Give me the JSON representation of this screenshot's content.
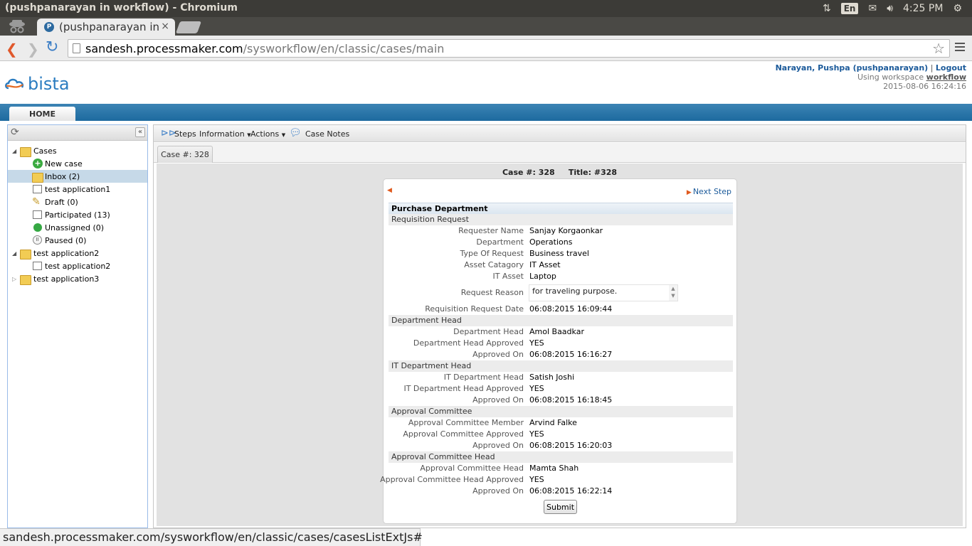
{
  "os": {
    "window_title": "(pushpanarayan in workflow) - Chromium",
    "lang": "En",
    "time": "4:25 PM"
  },
  "browser": {
    "tab_title": "(pushpanarayan in",
    "tab_favicon_letter": "P",
    "url_host": "sandesh.processmaker.com",
    "url_path": "/sysworkflow/en/classic/cases/main",
    "status_url": "sandesh.processmaker.com/sysworkflow/en/classic/cases/casesListExtJs#"
  },
  "header": {
    "logo_text": "bista",
    "user_name": "Narayan, Pushpa (pushpanarayan)",
    "separator": "|",
    "logout": "Logout",
    "workspace_prefix": "Using workspace",
    "workspace": "workflow",
    "datetime": "2015-08-06 16:24:16"
  },
  "menu": {
    "home": "HOME"
  },
  "tree": {
    "root": "Cases",
    "items": [
      {
        "label": "New case"
      },
      {
        "label": "Inbox (2)"
      },
      {
        "label": "test application1"
      },
      {
        "label": "Draft (0)"
      },
      {
        "label": "Participated (13)"
      },
      {
        "label": "Unassigned (0)"
      },
      {
        "label": "Paused (0)"
      }
    ],
    "group2": "test application2",
    "group2_child": "test application2",
    "group3": "test application3"
  },
  "toolbar": {
    "steps": "Steps",
    "information": "Information",
    "actions": "Actions",
    "case_notes": "Case Notes"
  },
  "case_tab": "Case #: 328",
  "case_header": {
    "case_label": "Case #: 328",
    "title_label": "Title: #328"
  },
  "form": {
    "next_step": "Next Step",
    "title": "Purchase Department",
    "sections": [
      "Requisition Request",
      "Department Head",
      "IT Department Head",
      "Approval Committee",
      "Approval Committee Head"
    ],
    "requisition": [
      {
        "label": "Requester Name",
        "value": "Sanjay Korgaonkar"
      },
      {
        "label": "Department",
        "value": "Operations"
      },
      {
        "label": "Type Of Request",
        "value": "Business travel"
      },
      {
        "label": "Asset Catagory",
        "value": "IT Asset"
      },
      {
        "label": "IT Asset",
        "value": "Laptop"
      }
    ],
    "reason_label": "Request Reason",
    "reason_value": "for traveling purpose.",
    "req_date_label": "Requisition Request Date",
    "req_date_value": "06:08:2015 16:09:44",
    "dept_head": [
      {
        "label": "Department Head",
        "value": "Amol Baadkar"
      },
      {
        "label": "Department Head Approved",
        "value": "YES"
      },
      {
        "label": "Approved On",
        "value": "06:08:2015 16:16:27"
      }
    ],
    "it_head": [
      {
        "label": "IT Department Head",
        "value": "Satish Joshi"
      },
      {
        "label": "IT Department Head Approved",
        "value": "YES"
      },
      {
        "label": "Approved On",
        "value": "06:08:2015 16:18:45"
      }
    ],
    "committee": [
      {
        "label": "Approval Committee Member",
        "value": "Arvind Falke"
      },
      {
        "label": "Approval Committee Approved",
        "value": "YES"
      },
      {
        "label": "Approved On",
        "value": "06:08:2015 16:20:03"
      }
    ],
    "committee_head": [
      {
        "label": "Approval Committee Head",
        "value": "Mamta Shah"
      },
      {
        "label": "Approval Committee Head Approved",
        "value": "YES"
      },
      {
        "label": "Approved On",
        "value": "06:08:2015 16:22:14"
      }
    ],
    "submit": "Submit"
  }
}
